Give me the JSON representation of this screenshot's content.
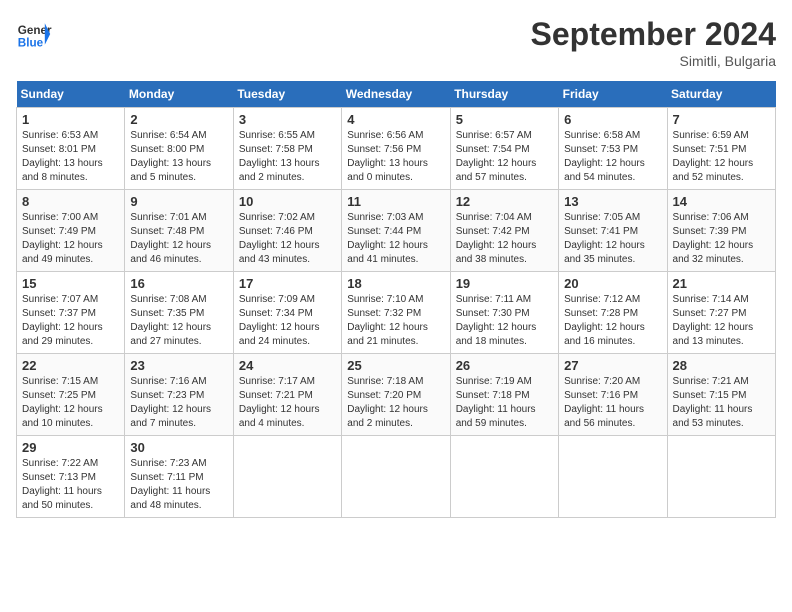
{
  "logo": {
    "line1": "General",
    "line2": "Blue"
  },
  "title": "September 2024",
  "location": "Simitli, Bulgaria",
  "days_of_week": [
    "Sunday",
    "Monday",
    "Tuesday",
    "Wednesday",
    "Thursday",
    "Friday",
    "Saturday"
  ],
  "weeks": [
    [
      {
        "num": "1",
        "info": "Sunrise: 6:53 AM\nSunset: 8:01 PM\nDaylight: 13 hours\nand 8 minutes."
      },
      {
        "num": "2",
        "info": "Sunrise: 6:54 AM\nSunset: 8:00 PM\nDaylight: 13 hours\nand 5 minutes."
      },
      {
        "num": "3",
        "info": "Sunrise: 6:55 AM\nSunset: 7:58 PM\nDaylight: 13 hours\nand 2 minutes."
      },
      {
        "num": "4",
        "info": "Sunrise: 6:56 AM\nSunset: 7:56 PM\nDaylight: 13 hours\nand 0 minutes."
      },
      {
        "num": "5",
        "info": "Sunrise: 6:57 AM\nSunset: 7:54 PM\nDaylight: 12 hours\nand 57 minutes."
      },
      {
        "num": "6",
        "info": "Sunrise: 6:58 AM\nSunset: 7:53 PM\nDaylight: 12 hours\nand 54 minutes."
      },
      {
        "num": "7",
        "info": "Sunrise: 6:59 AM\nSunset: 7:51 PM\nDaylight: 12 hours\nand 52 minutes."
      }
    ],
    [
      {
        "num": "8",
        "info": "Sunrise: 7:00 AM\nSunset: 7:49 PM\nDaylight: 12 hours\nand 49 minutes."
      },
      {
        "num": "9",
        "info": "Sunrise: 7:01 AM\nSunset: 7:48 PM\nDaylight: 12 hours\nand 46 minutes."
      },
      {
        "num": "10",
        "info": "Sunrise: 7:02 AM\nSunset: 7:46 PM\nDaylight: 12 hours\nand 43 minutes."
      },
      {
        "num": "11",
        "info": "Sunrise: 7:03 AM\nSunset: 7:44 PM\nDaylight: 12 hours\nand 41 minutes."
      },
      {
        "num": "12",
        "info": "Sunrise: 7:04 AM\nSunset: 7:42 PM\nDaylight: 12 hours\nand 38 minutes."
      },
      {
        "num": "13",
        "info": "Sunrise: 7:05 AM\nSunset: 7:41 PM\nDaylight: 12 hours\nand 35 minutes."
      },
      {
        "num": "14",
        "info": "Sunrise: 7:06 AM\nSunset: 7:39 PM\nDaylight: 12 hours\nand 32 minutes."
      }
    ],
    [
      {
        "num": "15",
        "info": "Sunrise: 7:07 AM\nSunset: 7:37 PM\nDaylight: 12 hours\nand 29 minutes."
      },
      {
        "num": "16",
        "info": "Sunrise: 7:08 AM\nSunset: 7:35 PM\nDaylight: 12 hours\nand 27 minutes."
      },
      {
        "num": "17",
        "info": "Sunrise: 7:09 AM\nSunset: 7:34 PM\nDaylight: 12 hours\nand 24 minutes."
      },
      {
        "num": "18",
        "info": "Sunrise: 7:10 AM\nSunset: 7:32 PM\nDaylight: 12 hours\nand 21 minutes."
      },
      {
        "num": "19",
        "info": "Sunrise: 7:11 AM\nSunset: 7:30 PM\nDaylight: 12 hours\nand 18 minutes."
      },
      {
        "num": "20",
        "info": "Sunrise: 7:12 AM\nSunset: 7:28 PM\nDaylight: 12 hours\nand 16 minutes."
      },
      {
        "num": "21",
        "info": "Sunrise: 7:14 AM\nSunset: 7:27 PM\nDaylight: 12 hours\nand 13 minutes."
      }
    ],
    [
      {
        "num": "22",
        "info": "Sunrise: 7:15 AM\nSunset: 7:25 PM\nDaylight: 12 hours\nand 10 minutes."
      },
      {
        "num": "23",
        "info": "Sunrise: 7:16 AM\nSunset: 7:23 PM\nDaylight: 12 hours\nand 7 minutes."
      },
      {
        "num": "24",
        "info": "Sunrise: 7:17 AM\nSunset: 7:21 PM\nDaylight: 12 hours\nand 4 minutes."
      },
      {
        "num": "25",
        "info": "Sunrise: 7:18 AM\nSunset: 7:20 PM\nDaylight: 12 hours\nand 2 minutes."
      },
      {
        "num": "26",
        "info": "Sunrise: 7:19 AM\nSunset: 7:18 PM\nDaylight: 11 hours\nand 59 minutes."
      },
      {
        "num": "27",
        "info": "Sunrise: 7:20 AM\nSunset: 7:16 PM\nDaylight: 11 hours\nand 56 minutes."
      },
      {
        "num": "28",
        "info": "Sunrise: 7:21 AM\nSunset: 7:15 PM\nDaylight: 11 hours\nand 53 minutes."
      }
    ],
    [
      {
        "num": "29",
        "info": "Sunrise: 7:22 AM\nSunset: 7:13 PM\nDaylight: 11 hours\nand 50 minutes."
      },
      {
        "num": "30",
        "info": "Sunrise: 7:23 AM\nSunset: 7:11 PM\nDaylight: 11 hours\nand 48 minutes."
      },
      {
        "num": "",
        "info": ""
      },
      {
        "num": "",
        "info": ""
      },
      {
        "num": "",
        "info": ""
      },
      {
        "num": "",
        "info": ""
      },
      {
        "num": "",
        "info": ""
      }
    ]
  ]
}
